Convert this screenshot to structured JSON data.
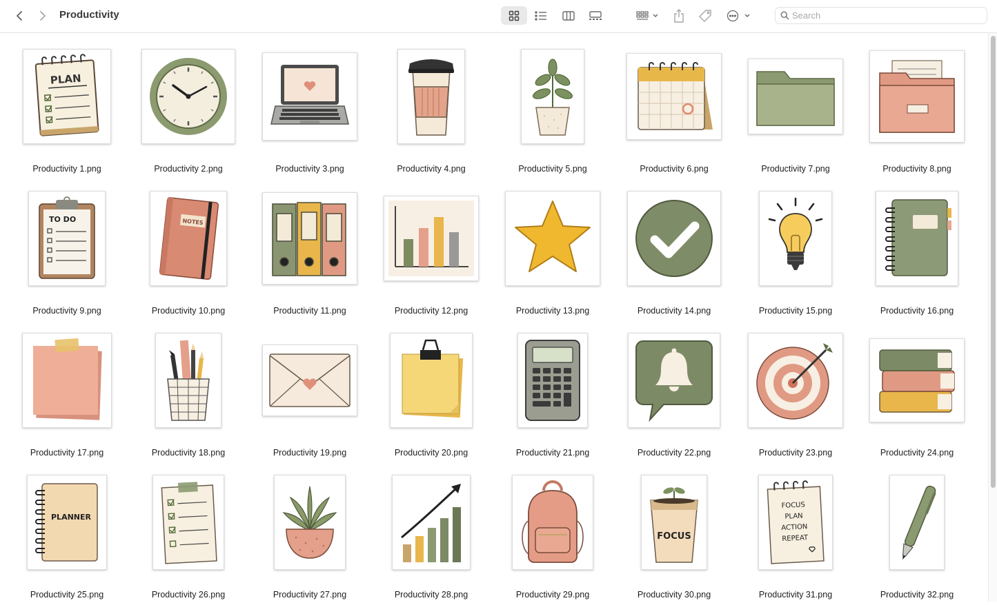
{
  "toolbar": {
    "title": "Productivity",
    "search_placeholder": "Search"
  },
  "files": [
    {
      "name": "Productivity 1.png",
      "icon": "plan-notepad-icon"
    },
    {
      "name": "Productivity 2.png",
      "icon": "clock-icon"
    },
    {
      "name": "Productivity 3.png",
      "icon": "laptop-icon"
    },
    {
      "name": "Productivity 4.png",
      "icon": "coffee-cup-icon"
    },
    {
      "name": "Productivity 5.png",
      "icon": "potted-plant-icon"
    },
    {
      "name": "Productivity 6.png",
      "icon": "calendar-icon"
    },
    {
      "name": "Productivity 7.png",
      "icon": "folder-icon"
    },
    {
      "name": "Productivity 8.png",
      "icon": "file-folder-icon"
    },
    {
      "name": "Productivity 9.png",
      "icon": "todo-clipboard-icon"
    },
    {
      "name": "Productivity 10.png",
      "icon": "notes-book-icon"
    },
    {
      "name": "Productivity 11.png",
      "icon": "binders-icon"
    },
    {
      "name": "Productivity 12.png",
      "icon": "bar-chart-icon"
    },
    {
      "name": "Productivity 13.png",
      "icon": "star-icon"
    },
    {
      "name": "Productivity 14.png",
      "icon": "checkmark-icon"
    },
    {
      "name": "Productivity 15.png",
      "icon": "lightbulb-icon"
    },
    {
      "name": "Productivity 16.png",
      "icon": "spiral-notebook-icon"
    },
    {
      "name": "Productivity 17.png",
      "icon": "sticky-note-icon"
    },
    {
      "name": "Productivity 18.png",
      "icon": "pencil-cup-icon"
    },
    {
      "name": "Productivity 19.png",
      "icon": "envelope-icon"
    },
    {
      "name": "Productivity 20.png",
      "icon": "clipped-notes-icon"
    },
    {
      "name": "Productivity 21.png",
      "icon": "calculator-icon"
    },
    {
      "name": "Productivity 22.png",
      "icon": "notification-bell-icon"
    },
    {
      "name": "Productivity 23.png",
      "icon": "target-icon"
    },
    {
      "name": "Productivity 24.png",
      "icon": "book-stack-icon"
    },
    {
      "name": "Productivity 25.png",
      "icon": "planner-notebook-icon"
    },
    {
      "name": "Productivity 26.png",
      "icon": "checklist-icon"
    },
    {
      "name": "Productivity 27.png",
      "icon": "succulent-icon"
    },
    {
      "name": "Productivity 28.png",
      "icon": "growth-chart-icon"
    },
    {
      "name": "Productivity 29.png",
      "icon": "backpack-icon"
    },
    {
      "name": "Productivity 30.png",
      "icon": "focus-cup-icon"
    },
    {
      "name": "Productivity 31.png",
      "icon": "focus-notepad-icon"
    },
    {
      "name": "Productivity 32.png",
      "icon": "pen-icon"
    }
  ],
  "artwork_text": {
    "plan": "PLAN",
    "todo": "TO DO",
    "notes": "NOTES",
    "planner": "PLANNER",
    "focus": "FOCUS",
    "focus_list": [
      "FOCUS",
      "PLAN",
      "ACTION",
      "REPEAT"
    ]
  }
}
